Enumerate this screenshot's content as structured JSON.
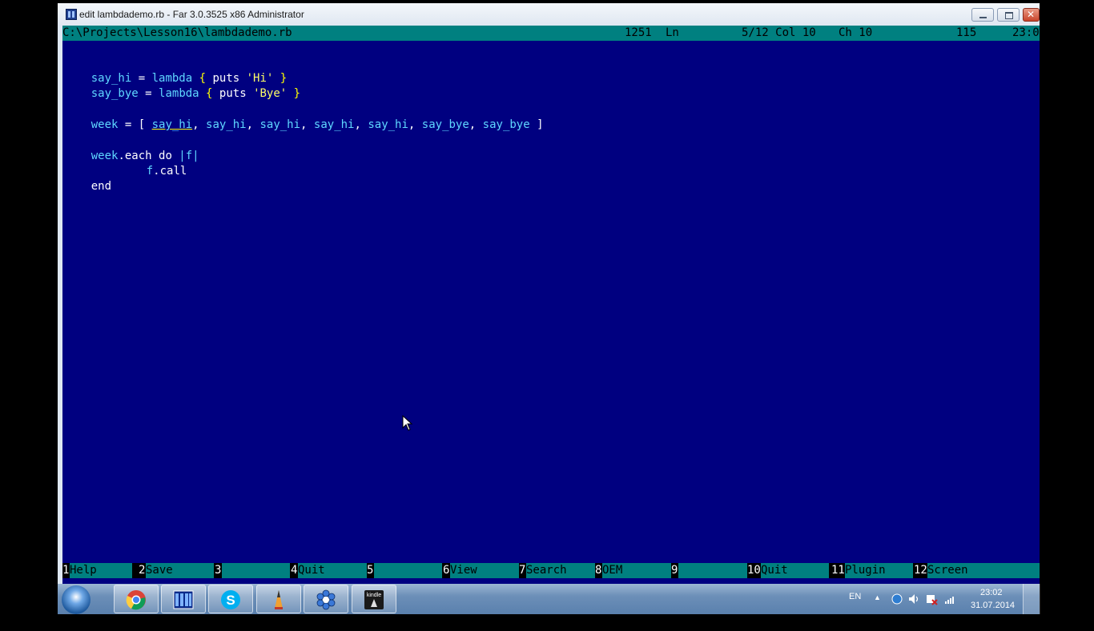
{
  "window": {
    "title": "edit lambdademo.rb - Far 3.0.3525 x86 Administrator"
  },
  "status": {
    "path": "C:\\Projects\\Lesson16\\lambdademo.rb",
    "codepage": "1251",
    "ln_label": "Ln",
    "position": "5/12 Col 10",
    "ch": "Ch 10",
    "code": "115",
    "clock": "23:0"
  },
  "code": {
    "l1_a": "say_hi",
    "l1_b": " = ",
    "l1_c": "lambda",
    "l1_d": " { ",
    "l1_e": "puts",
    "l1_f": " ",
    "l1_g": "'Hi'",
    "l1_h": " }",
    "l2_a": "say_bye",
    "l2_b": " = ",
    "l2_c": "lambda",
    "l2_d": " { ",
    "l2_e": "puts",
    "l2_f": " ",
    "l2_g": "'Bye'",
    "l2_h": " }",
    "l3_a": "week",
    "l3_b": " = [ ",
    "l3_items": [
      "say_hi",
      "say_hi",
      "say_hi",
      "say_hi",
      "say_hi",
      "say_bye",
      "say_bye"
    ],
    "l3_sep": ", ",
    "l3_end": " ]",
    "l4_a": "week",
    "l4_b": ".each do ",
    "l4_c": "|f|",
    "l5_a": "f",
    "l5_b": ".call",
    "l6": "end"
  },
  "keybar": [
    {
      "n": "1",
      "label": "Help"
    },
    {
      "n": "2",
      "label": "Save"
    },
    {
      "n": "3",
      "label": ""
    },
    {
      "n": "4",
      "label": "Quit"
    },
    {
      "n": "5",
      "label": ""
    },
    {
      "n": "6",
      "label": "View"
    },
    {
      "n": "7",
      "label": "Search"
    },
    {
      "n": "8",
      "label": "OEM"
    },
    {
      "n": "9",
      "label": ""
    },
    {
      "n": "10",
      "label": "Quit"
    },
    {
      "n": "11",
      "label": "Plugin"
    },
    {
      "n": "12",
      "label": "Screen"
    }
  ],
  "taskbar": {
    "icons": [
      "start-orb-icon",
      "chrome-icon",
      "far-manager-icon",
      "skype-icon",
      "pencil-icon",
      "gear-flower-icon",
      "kindle-icon"
    ],
    "kindle_text": "kindle",
    "lang": "EN",
    "time": "23:02",
    "date": "31.07.2014"
  },
  "colors": {
    "background": "#000080",
    "status_bar": "#008080",
    "identifier": "#5fd7ff",
    "string": "#ffff66",
    "brace": "#ffff00"
  }
}
